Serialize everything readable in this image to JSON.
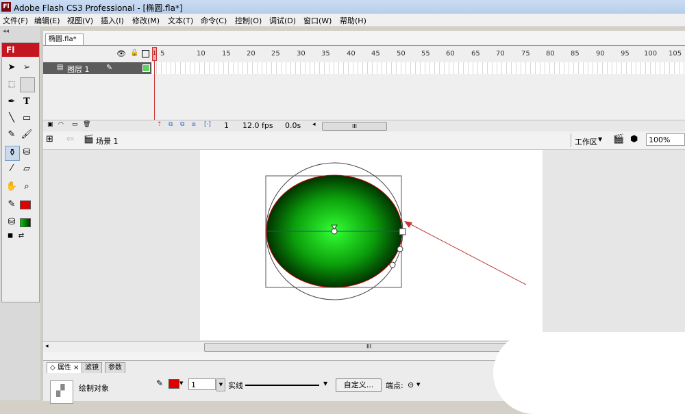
{
  "window": {
    "title": "Adobe Flash CS3 Professional - [椭圆.fla*]",
    "logo": "Fl"
  },
  "menu": [
    "文件(F)",
    "编辑(E)",
    "视图(V)",
    "插入(I)",
    "修改(M)",
    "文本(T)",
    "命令(C)",
    "控制(O)",
    "调试(D)",
    "窗口(W)",
    "帮助(H)"
  ],
  "tools": {
    "header": "Fl",
    "text_tool": "T"
  },
  "document": {
    "tab_label": "椭圆.fla*"
  },
  "timeline": {
    "ruler_ticks": [
      "1",
      "5",
      "10",
      "15",
      "20",
      "25",
      "30",
      "35",
      "40",
      "45",
      "50",
      "55",
      "60",
      "65",
      "70",
      "75",
      "80",
      "85",
      "90",
      "95",
      "100",
      "105"
    ],
    "layer_name": "图层 1",
    "current_frame": "1",
    "fps": "12.0 fps",
    "elapsed": "0.0s",
    "scroll_grip": "III"
  },
  "scene": {
    "name": "场景 1",
    "workspace": "工作区",
    "zoom": "100%"
  },
  "stage": {
    "hscroll_grip": "III"
  },
  "properties": {
    "tabs": [
      "属性",
      "滤镜",
      "参数"
    ],
    "object_type": "绘制对象",
    "stroke_width": "1",
    "stroke_style": "实线",
    "custom_button": "自定义...",
    "cap_label": "端点:"
  },
  "colors": {
    "stroke": "#e00000",
    "fill_center": "#33ff33",
    "fill_edge": "#003300",
    "accent_red": "#c41620"
  }
}
